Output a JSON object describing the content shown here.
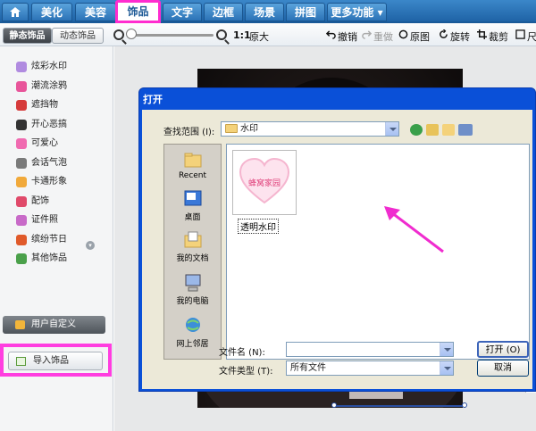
{
  "top_tabs": [
    {
      "label": "美化"
    },
    {
      "label": "美容"
    },
    {
      "label": "饰品"
    },
    {
      "label": "文字"
    },
    {
      "label": "边框"
    },
    {
      "label": "场景"
    },
    {
      "label": "拼图"
    },
    {
      "label": "更多功能 ▾"
    }
  ],
  "toolbar": {
    "static_tab": "静态饰品",
    "dynamic_tab": "动态饰品",
    "ratio": "1:1",
    "original_size": "原大",
    "undo": "撤销",
    "redo": "重做",
    "original": "原图",
    "rotate": "旋转",
    "crop": "裁剪",
    "size": "尺寸"
  },
  "sidebar": {
    "items": [
      {
        "label": "炫彩水印",
        "icon": "sparkle-icon",
        "color": "#b08be0"
      },
      {
        "label": "潮流涂鸦",
        "icon": "lips-icon",
        "color": "#e8559a"
      },
      {
        "label": "遮挡物",
        "icon": "mask-icon",
        "color": "#d63b3b"
      },
      {
        "label": "开心恶搞",
        "icon": "glasses-icon",
        "color": "#333333"
      },
      {
        "label": "可爱心",
        "icon": "heart-icon",
        "color": "#f06ab0"
      },
      {
        "label": "会话气泡",
        "icon": "speech-bubble-icon",
        "color": "#7a7a7a"
      },
      {
        "label": "卡通形象",
        "icon": "cartoon-face-icon",
        "color": "#f1a93a"
      },
      {
        "label": "配饰",
        "icon": "accessory-icon",
        "color": "#e04a6a"
      },
      {
        "label": "证件照",
        "icon": "id-photo-icon",
        "color": "#c86ac8"
      },
      {
        "label": "缤纷节日",
        "icon": "gift-icon",
        "color": "#e05a2a"
      },
      {
        "label": "其他饰品",
        "icon": "other-icon",
        "color": "#4aa04a"
      }
    ],
    "user_defined": "用户自定义",
    "import_button": "导入饰品"
  },
  "dialog": {
    "title": "打开",
    "lookin_label": "查找范围 (I):",
    "lookin_value": "水印",
    "places": [
      {
        "label": "Recent",
        "icon": "recent-folder-icon"
      },
      {
        "label": "桌面",
        "icon": "desktop-icon"
      },
      {
        "label": "我的文档",
        "icon": "my-documents-icon"
      },
      {
        "label": "我的电脑",
        "icon": "my-computer-icon"
      },
      {
        "label": "网上邻居",
        "icon": "network-places-icon"
      }
    ],
    "file": {
      "name": "透明水印",
      "thumb_text": "蜂窝家园"
    },
    "filename_label": "文件名 (N):",
    "filename_value": "",
    "filetype_label": "文件类型 (T):",
    "filetype_value": "所有文件",
    "open_button": "打开 (O)",
    "cancel_button": "取消"
  },
  "colors": {
    "accent": "#1f63a6",
    "highlight": "#ff2ccf",
    "dialog_title": "#0a50d8"
  }
}
